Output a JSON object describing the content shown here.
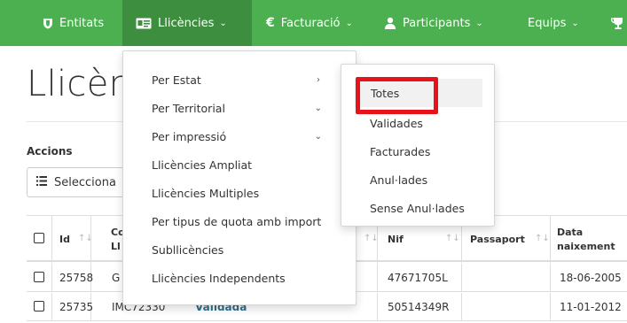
{
  "nav": {
    "items": [
      {
        "icon": "shield-icon",
        "glyph": "⛉",
        "label": "Entitats"
      },
      {
        "icon": "id-card-icon",
        "glyph": "▤",
        "label": "Llicències",
        "chevron": "⌄"
      },
      {
        "icon": "euro-icon",
        "glyph": "€",
        "label": "Facturació",
        "chevron": "⌄"
      },
      {
        "icon": "user-icon",
        "glyph": "●",
        "label": "Participants",
        "chevron": "⌄"
      },
      {
        "label": "Equips",
        "chevron": "⌄"
      },
      {
        "icon": "trophy-icon",
        "glyph": "🏆"
      }
    ]
  },
  "page": {
    "title": "Llicènc",
    "accions_label": "Accions",
    "select_label": "Selecciona",
    "select_icon": "list-icon"
  },
  "table": {
    "headers": {
      "id": "Id",
      "code_top": "Co",
      "code_bottom": "Ll",
      "nif": "Nif",
      "passaport": "Passaport",
      "naixement_top": "Data",
      "naixement_bottom": "naixement"
    },
    "rows": [
      {
        "id": "25758",
        "code": "G",
        "status": "",
        "nif": "47671705L",
        "passaport": "",
        "naixement": "18-06-2005"
      },
      {
        "id": "25735",
        "code": "IMC72330",
        "status": "Validada",
        "nif": "50514349R",
        "passaport": "",
        "naixement": "11-01-2012"
      }
    ]
  },
  "dropdown": {
    "items": [
      {
        "label": "Per Estat",
        "chevron": "›"
      },
      {
        "label": "Per Territorial",
        "chevron": "⌄"
      },
      {
        "label": "Per impressió",
        "chevron": "⌄"
      },
      {
        "label": "Llicències Ampliat"
      },
      {
        "label": "Llicències Multiples"
      },
      {
        "label": "Per tipus de quota amb import"
      },
      {
        "label": "Subllicències"
      },
      {
        "label": "Llicències Independents"
      }
    ]
  },
  "submenu": {
    "items": [
      {
        "label": "Totes"
      },
      {
        "label": "Validades"
      },
      {
        "label": "Facturades"
      },
      {
        "label": "Anul·lades"
      },
      {
        "label": "Sense Anul·lades"
      }
    ]
  },
  "colors": {
    "nav_bg": "#4caf50",
    "nav_active": "#3d8f3f",
    "highlight": "#e8121a",
    "status": "#2f6f8f"
  }
}
